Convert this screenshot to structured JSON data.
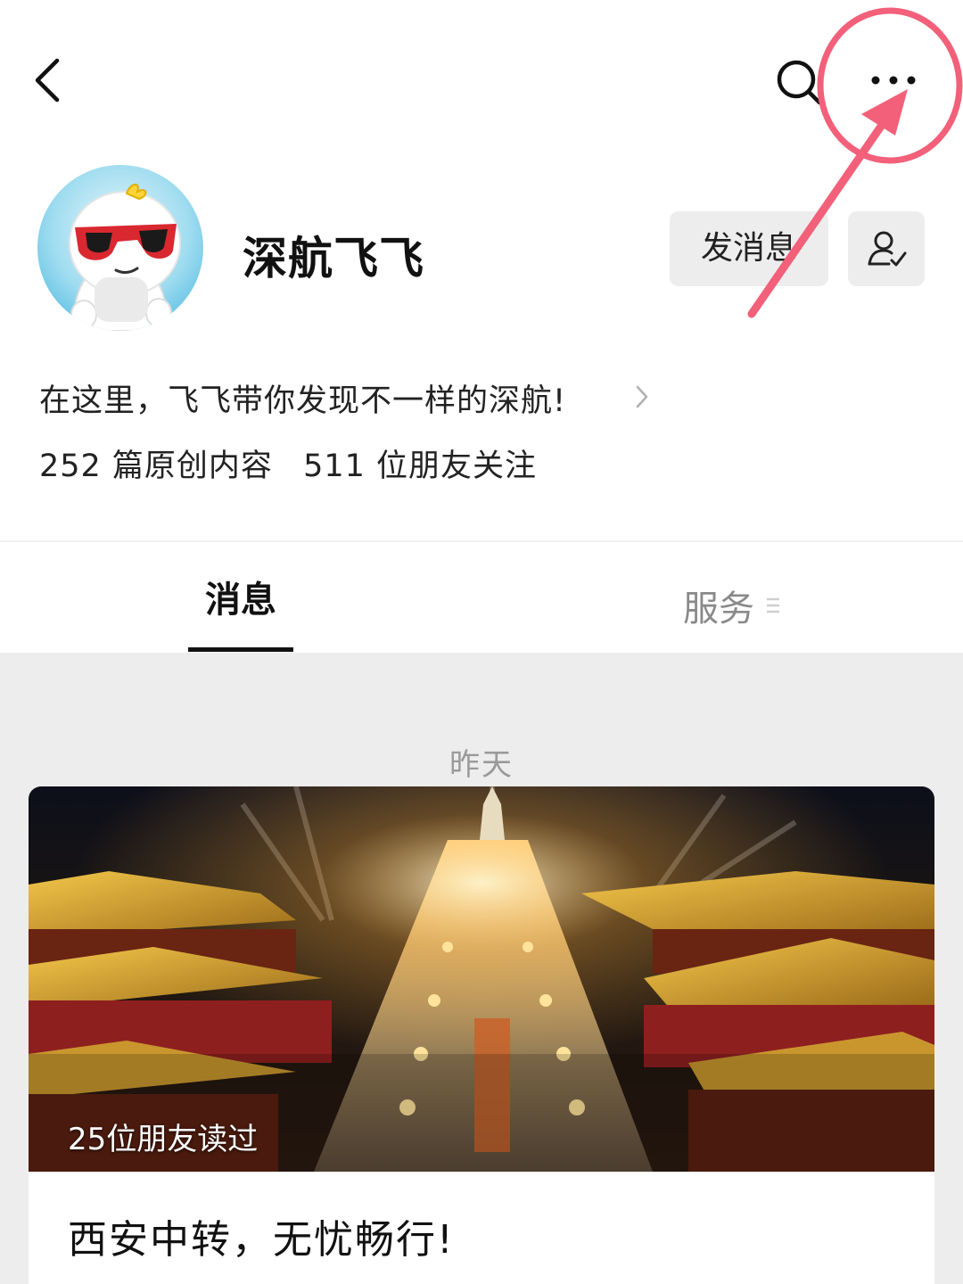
{
  "header": {
    "back_icon": "chevron-left-icon",
    "search_icon": "search-icon",
    "more_icon": "more-horizontal-icon"
  },
  "profile": {
    "name": "深航飞飞",
    "message_button_label": "发消息",
    "follow_icon": "user-check-icon",
    "intro": "在这里，飞飞带你发现不一样的深航!",
    "stats": {
      "articles": "252 篇原创内容",
      "followers": "511 位朋友关注"
    }
  },
  "tabs": [
    {
      "label": "消息",
      "active": true
    },
    {
      "label": "服务",
      "active": false
    }
  ],
  "feed": {
    "date": "昨天",
    "articles": [
      {
        "read_count": "25位朋友读过",
        "title": "西安中转，无忧畅行!"
      }
    ]
  },
  "colors": {
    "annotation": "#f2607a",
    "button_bg": "#ededed",
    "feed_bg": "#ededed"
  }
}
